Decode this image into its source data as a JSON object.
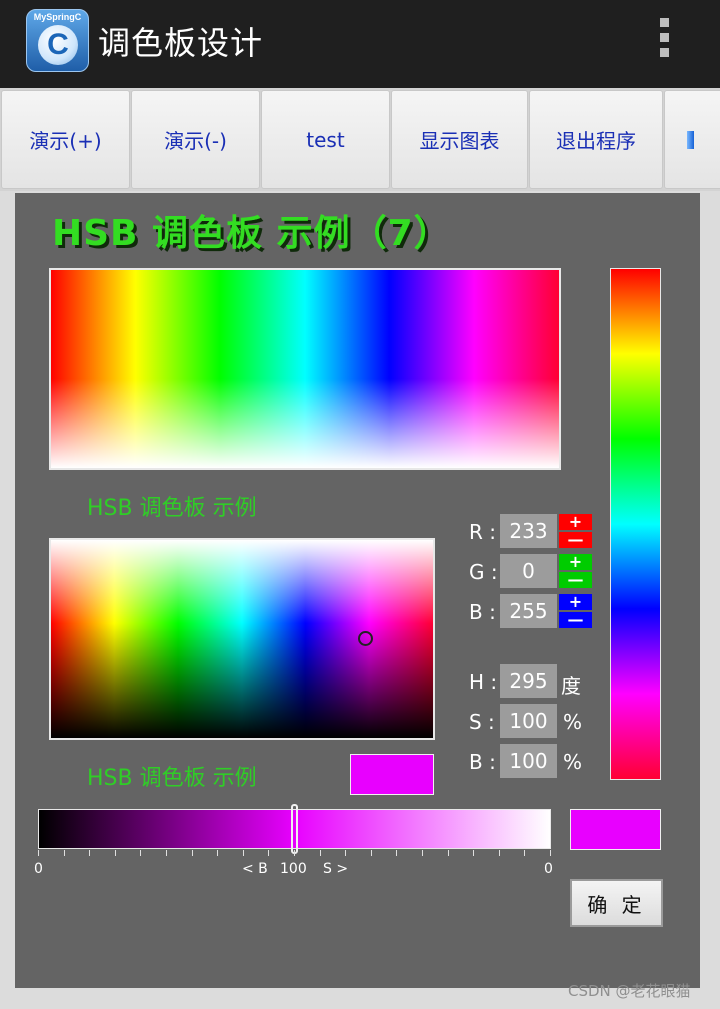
{
  "app": {
    "brand": "MySpringC",
    "brand_letter": "C",
    "title": "调色板设计"
  },
  "toolbar": {
    "items": [
      {
        "label": "演示(+)"
      },
      {
        "label": "演示(-)"
      },
      {
        "label": "test"
      },
      {
        "label": "显示图表"
      },
      {
        "label": "退出程序"
      }
    ]
  },
  "palette": {
    "headline": "HSB 调色板 示例（7）",
    "caption_top": "HSB 调色板  示例",
    "caption_bottom": "HSB 调色板  示例",
    "selected_color": "#e800ff"
  },
  "rgb": {
    "r": {
      "label": "R :",
      "value": "233",
      "plus": "+",
      "minus": "—",
      "color": "#ff0000"
    },
    "g": {
      "label": "G :",
      "value": "0",
      "plus": "+",
      "minus": "—",
      "color": "#00cc00"
    },
    "b": {
      "label": "B :",
      "value": "255",
      "plus": "+",
      "minus": "—",
      "color": "#0000ff"
    }
  },
  "hsb": {
    "h": {
      "label": "H :",
      "value": "295",
      "unit": "度"
    },
    "s": {
      "label": "S :",
      "value": "100",
      "unit": "%"
    },
    "b": {
      "label": "B :",
      "value": "100",
      "unit": "%"
    }
  },
  "slider": {
    "min_label": "0",
    "max_label": "0",
    "left_hint": "< B",
    "center_value": "100",
    "right_hint": "S >",
    "position": 0.5
  },
  "confirm_label": "确 定",
  "watermark": "CSDN @老花眼猫"
}
